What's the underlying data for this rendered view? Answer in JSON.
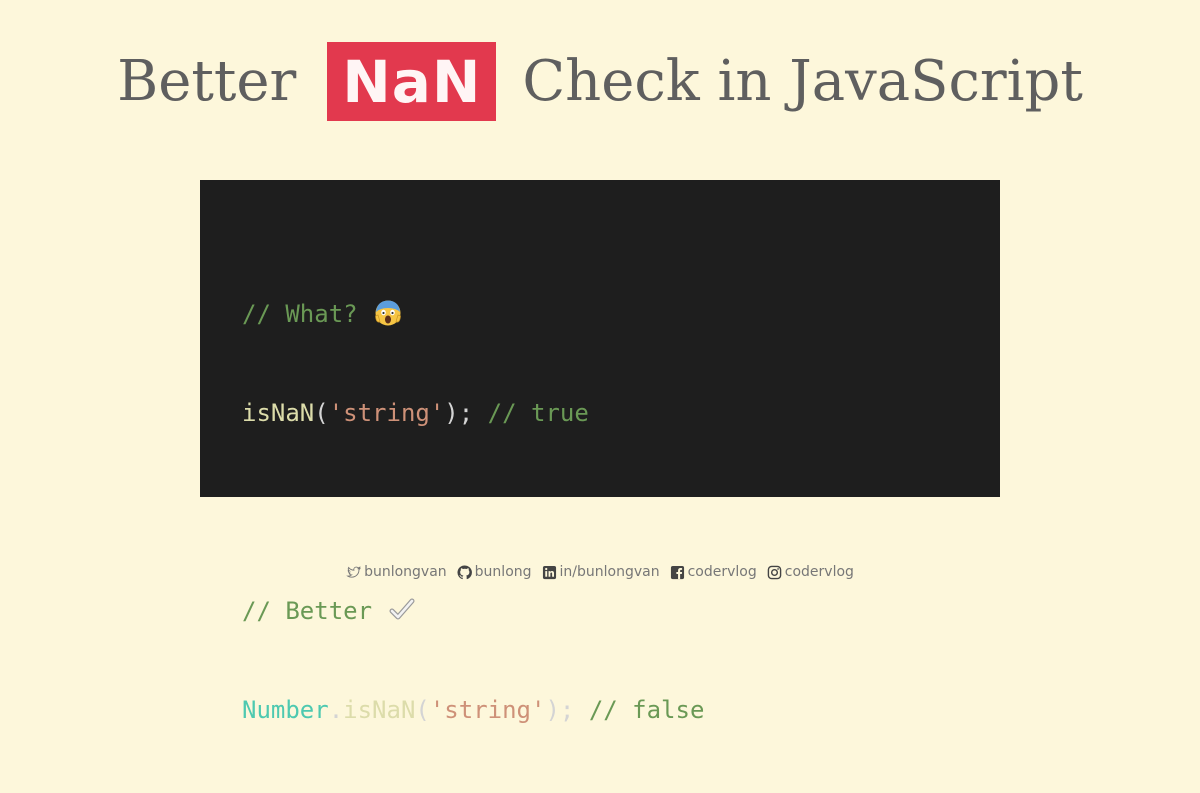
{
  "header": {
    "title_before": "Better",
    "badge": "NaN",
    "title_after": "Check in JavaScript"
  },
  "code": {
    "line1_comment": "// What?",
    "line1_emoji": "face-screaming-in-fear-icon",
    "line2_fn": "isNaN",
    "line2_open": "(",
    "line2_string": "'string'",
    "line2_close": ");",
    "line2_comment": "// true",
    "line4_comment": "// Better",
    "line4_emoji": "check-mark-icon",
    "line5_class": "Number",
    "line5_dot": ".",
    "line5_fn": "isNaN",
    "line5_open": "(",
    "line5_string": "'string'",
    "line5_close": ");",
    "line5_comment": "// false"
  },
  "footer": {
    "twitter": "bunlongvan",
    "github": "bunlong",
    "linkedin": "in/bunlongvan",
    "facebook": "codervlog",
    "instagram": "codervlog"
  },
  "colors": {
    "background": "#fdf7db",
    "badge": "#e2394e",
    "code_background": "#1e1e1e",
    "comment": "#6a9955",
    "function": "#dcdcaa",
    "string": "#ce9178",
    "class": "#4ec9b0"
  }
}
